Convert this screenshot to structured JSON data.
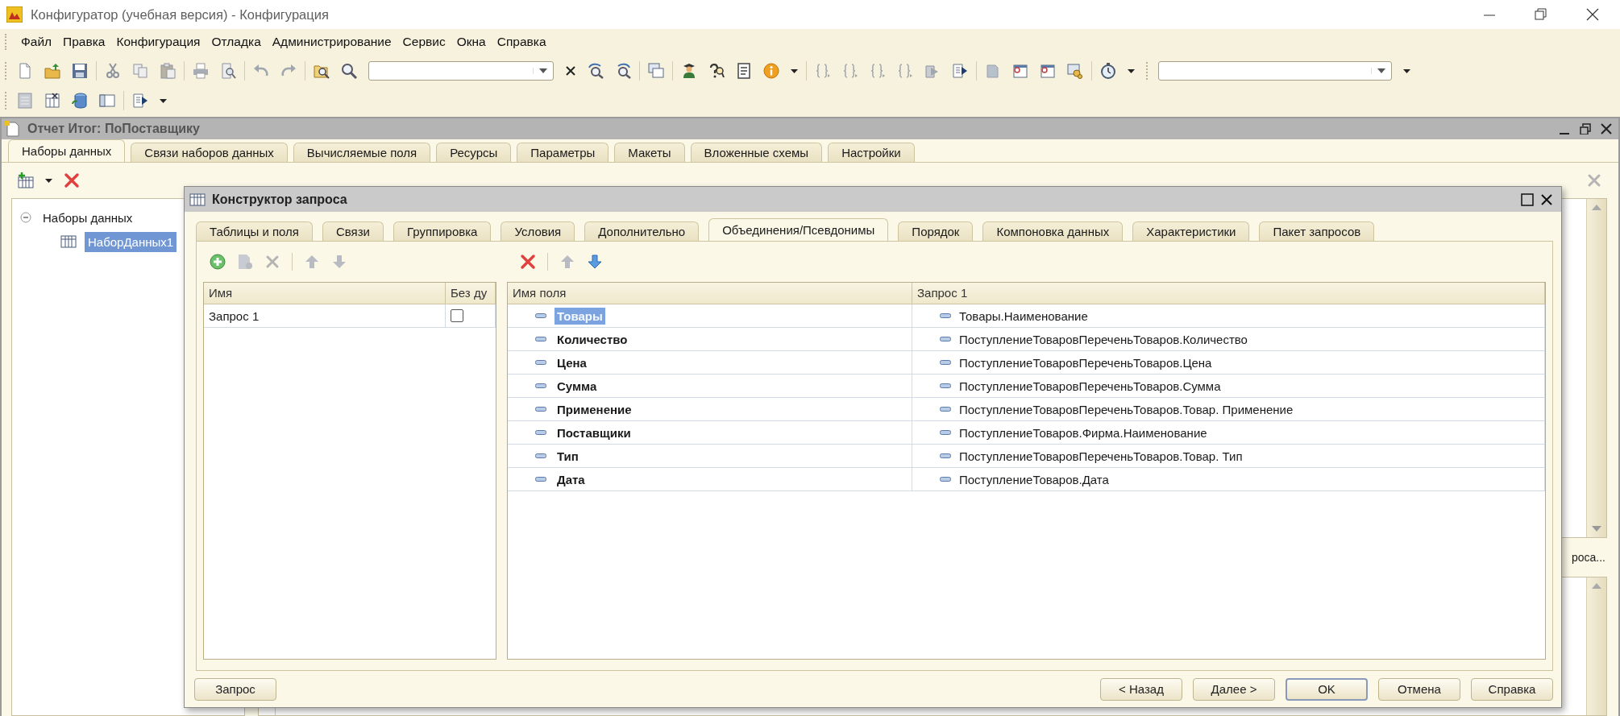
{
  "window": {
    "title": "Конфигуратор (учебная версия) - Конфигурация"
  },
  "menu": [
    {
      "label": "Файл"
    },
    {
      "label": "Правка"
    },
    {
      "label": "Конфигурация"
    },
    {
      "label": "Отладка"
    },
    {
      "label": "Администрирование"
    },
    {
      "label": "Сервис"
    },
    {
      "label": "Окна"
    },
    {
      "label": "Справка"
    }
  ],
  "document": {
    "title": "Отчет Итог: ПоПоставщику",
    "tabs": [
      {
        "label": "Наборы данных",
        "selected": true
      },
      {
        "label": "Связи наборов данных",
        "selected": false
      },
      {
        "label": "Вычисляемые поля",
        "selected": false
      },
      {
        "label": "Ресурсы",
        "selected": false
      },
      {
        "label": "Параметры",
        "selected": false
      },
      {
        "label": "Макеты",
        "selected": false
      },
      {
        "label": "Вложенные схемы",
        "selected": false
      },
      {
        "label": "Настройки",
        "selected": false
      }
    ],
    "tree": [
      {
        "label": "Наборы данных",
        "expanded": true,
        "selected": false,
        "children": [
          {
            "label": "НаборДанных1",
            "selected": true
          }
        ]
      }
    ],
    "caption": "роса..."
  },
  "dialog": {
    "title": "Конструктор запроса",
    "tabs": [
      {
        "label": "Таблицы и поля",
        "selected": false
      },
      {
        "label": "Связи",
        "selected": false
      },
      {
        "label": "Группировка",
        "selected": false
      },
      {
        "label": "Условия",
        "selected": false
      },
      {
        "label": "Дополнительно",
        "selected": false
      },
      {
        "label": "Объединения/Псевдонимы",
        "selected": true
      },
      {
        "label": "Порядок",
        "selected": false
      },
      {
        "label": "Компоновка данных",
        "selected": false
      },
      {
        "label": "Характеристики",
        "selected": false
      },
      {
        "label": "Пакет запросов",
        "selected": false
      }
    ],
    "queries": {
      "columns": [
        "Имя",
        "Без ду"
      ],
      "rows": [
        {
          "name": "Запрос 1",
          "checked": false
        }
      ]
    },
    "fields": {
      "columns": [
        "Имя поля",
        "Запрос 1"
      ],
      "rows": [
        {
          "name": "Товары",
          "source": "Товары.Наименование",
          "selected": true
        },
        {
          "name": "Количество",
          "source": "ПоступлениеТоваровПереченьТоваров.Количество",
          "selected": false
        },
        {
          "name": "Цена",
          "source": "ПоступлениеТоваровПереченьТоваров.Цена",
          "selected": false
        },
        {
          "name": "Сумма",
          "source": "ПоступлениеТоваровПереченьТоваров.Сумма",
          "selected": false
        },
        {
          "name": "Применение",
          "source": "ПоступлениеТоваровПереченьТоваров.Товар. Применение",
          "selected": false
        },
        {
          "name": "Поставщики",
          "source": "ПоступлениеТоваров.Фирма.Наименование",
          "selected": false
        },
        {
          "name": "Тип",
          "source": "ПоступлениеТоваровПереченьТоваров.Товар. Тип",
          "selected": false
        },
        {
          "name": "Дата",
          "source": "ПоступлениеТоваров.Дата",
          "selected": false
        }
      ]
    },
    "buttons": [
      {
        "label": "Запрос",
        "default": false
      },
      {
        "label": "< Назад",
        "default": false
      },
      {
        "label": "Далее >",
        "default": false
      },
      {
        "label": "OK",
        "default": true
      },
      {
        "label": "Отмена",
        "default": false
      },
      {
        "label": "Справка",
        "default": false
      }
    ]
  }
}
